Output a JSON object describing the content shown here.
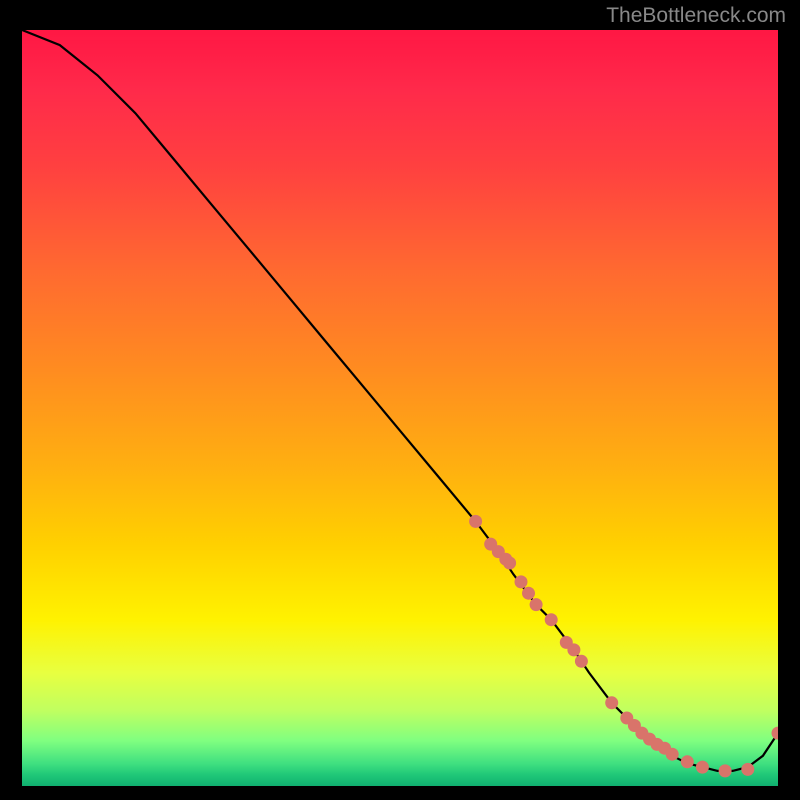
{
  "watermark": "TheBottleneck.com",
  "chart_data": {
    "type": "line",
    "title": "",
    "xlabel": "",
    "ylabel": "",
    "xlim": [
      0,
      100
    ],
    "ylim": [
      0,
      100
    ],
    "series": [
      {
        "name": "curve",
        "x": [
          0,
          5,
          10,
          15,
          20,
          25,
          30,
          35,
          40,
          45,
          50,
          55,
          60,
          63,
          65,
          68,
          70,
          73,
          75,
          78,
          80,
          82,
          84,
          86,
          88,
          90,
          92,
          94,
          96,
          98,
          100
        ],
        "y": [
          100,
          98,
          94,
          89,
          83,
          77,
          71,
          65,
          59,
          53,
          47,
          41,
          35,
          31,
          28,
          24,
          22,
          18,
          15,
          11,
          9,
          7,
          5,
          4,
          3,
          2.5,
          2,
          2,
          2.5,
          4,
          7
        ]
      }
    ],
    "points": {
      "name": "markers",
      "x": [
        60,
        62,
        63,
        64,
        64.5,
        66,
        67,
        68,
        70,
        72,
        73,
        74,
        78,
        80,
        81,
        82,
        83,
        84,
        85,
        86,
        88,
        90,
        93,
        96,
        100
      ],
      "y": [
        35,
        32,
        31,
        30,
        29.5,
        27,
        25.5,
        24,
        22,
        19,
        18,
        16.5,
        11,
        9,
        8,
        7,
        6.2,
        5.5,
        5,
        4.2,
        3.2,
        2.5,
        2,
        2.2,
        7
      ]
    }
  }
}
